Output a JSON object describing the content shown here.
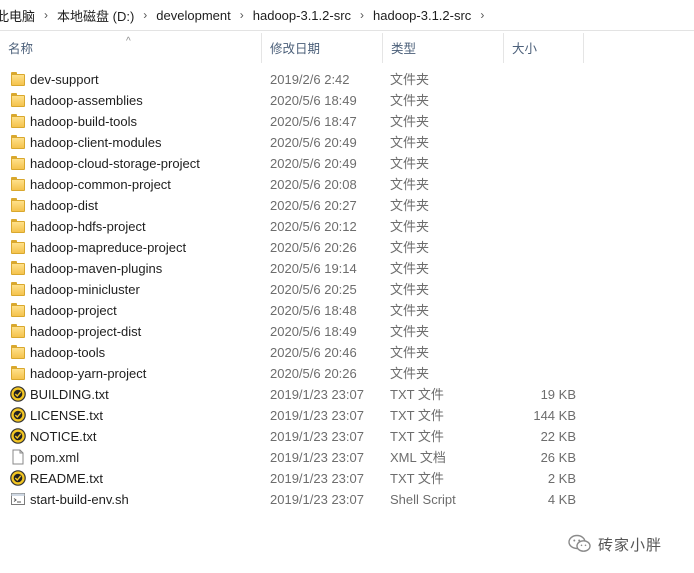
{
  "breadcrumb": [
    "此电脑",
    "本地磁盘 (D:)",
    "development",
    "hadoop-3.1.2-src",
    "hadoop-3.1.2-src"
  ],
  "columns": {
    "name": "名称",
    "date": "修改日期",
    "type": "类型",
    "size": "大小"
  },
  "rows": [
    {
      "name": "dev-support",
      "date": "2019/2/6 2:42",
      "type": "文件夹",
      "size": "",
      "icon": "folder-icon"
    },
    {
      "name": "hadoop-assemblies",
      "date": "2020/5/6 18:49",
      "type": "文件夹",
      "size": "",
      "icon": "folder-icon"
    },
    {
      "name": "hadoop-build-tools",
      "date": "2020/5/6 18:47",
      "type": "文件夹",
      "size": "",
      "icon": "folder-icon"
    },
    {
      "name": "hadoop-client-modules",
      "date": "2020/5/6 20:49",
      "type": "文件夹",
      "size": "",
      "icon": "folder-icon"
    },
    {
      "name": "hadoop-cloud-storage-project",
      "date": "2020/5/6 20:49",
      "type": "文件夹",
      "size": "",
      "icon": "folder-icon"
    },
    {
      "name": "hadoop-common-project",
      "date": "2020/5/6 20:08",
      "type": "文件夹",
      "size": "",
      "icon": "folder-icon"
    },
    {
      "name": "hadoop-dist",
      "date": "2020/5/6 20:27",
      "type": "文件夹",
      "size": "",
      "icon": "folder-icon"
    },
    {
      "name": "hadoop-hdfs-project",
      "date": "2020/5/6 20:12",
      "type": "文件夹",
      "size": "",
      "icon": "folder-icon"
    },
    {
      "name": "hadoop-mapreduce-project",
      "date": "2020/5/6 20:26",
      "type": "文件夹",
      "size": "",
      "icon": "folder-icon"
    },
    {
      "name": "hadoop-maven-plugins",
      "date": "2020/5/6 19:14",
      "type": "文件夹",
      "size": "",
      "icon": "folder-icon"
    },
    {
      "name": "hadoop-minicluster",
      "date": "2020/5/6 20:25",
      "type": "文件夹",
      "size": "",
      "icon": "folder-icon"
    },
    {
      "name": "hadoop-project",
      "date": "2020/5/6 18:48",
      "type": "文件夹",
      "size": "",
      "icon": "folder-icon"
    },
    {
      "name": "hadoop-project-dist",
      "date": "2020/5/6 18:49",
      "type": "文件夹",
      "size": "",
      "icon": "folder-icon"
    },
    {
      "name": "hadoop-tools",
      "date": "2020/5/6 20:46",
      "type": "文件夹",
      "size": "",
      "icon": "folder-icon"
    },
    {
      "name": "hadoop-yarn-project",
      "date": "2020/5/6 20:26",
      "type": "文件夹",
      "size": "",
      "icon": "folder-icon"
    },
    {
      "name": "BUILDING.txt",
      "date": "2019/1/23 23:07",
      "type": "TXT 文件",
      "size": "19 KB",
      "icon": "text-file-icon"
    },
    {
      "name": "LICENSE.txt",
      "date": "2019/1/23 23:07",
      "type": "TXT 文件",
      "size": "144 KB",
      "icon": "text-file-icon"
    },
    {
      "name": "NOTICE.txt",
      "date": "2019/1/23 23:07",
      "type": "TXT 文件",
      "size": "22 KB",
      "icon": "text-file-icon"
    },
    {
      "name": "pom.xml",
      "date": "2019/1/23 23:07",
      "type": "XML 文档",
      "size": "26 KB",
      "icon": "xml-file-icon"
    },
    {
      "name": "README.txt",
      "date": "2019/1/23 23:07",
      "type": "TXT 文件",
      "size": "2 KB",
      "icon": "text-file-icon"
    },
    {
      "name": "start-build-env.sh",
      "date": "2019/1/23 23:07",
      "type": "Shell Script",
      "size": "4 KB",
      "icon": "shell-script-icon"
    }
  ],
  "watermark": {
    "text": "砖家小胖",
    "icon": "wechat-icon"
  },
  "colors": {
    "header_text": "#4c607a",
    "secondary_text": "#6d6d6d",
    "folder": "#f5c24d"
  }
}
